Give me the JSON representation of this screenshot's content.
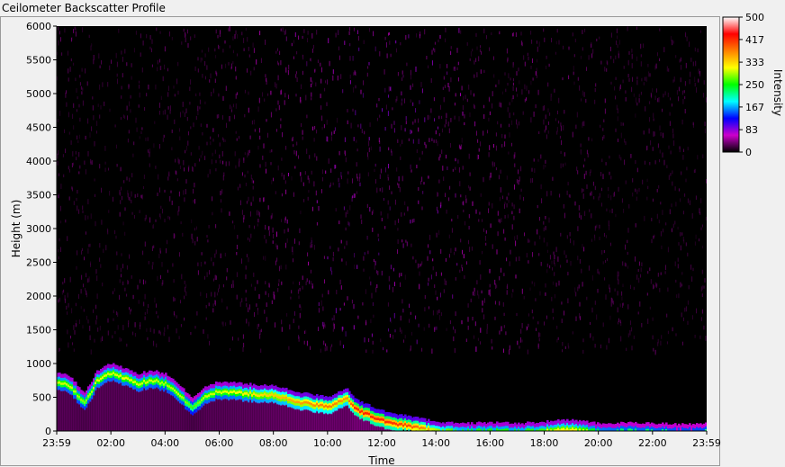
{
  "window": {
    "title": "Ceilometer Backscatter Profile"
  },
  "colors": {
    "background": "#000000",
    "scale": [
      "#000000",
      "#cc00cc",
      "#0000ff",
      "#00ffff",
      "#00ff00",
      "#ffff00",
      "#ff8000",
      "#ff0000",
      "#ffffff"
    ]
  },
  "chart_data": {
    "type": "heatmap",
    "title": "Ceilometer Backscatter Profile",
    "xlabel": "Time",
    "ylabel": "Height (m)",
    "x_ticks": [
      "23:59",
      "02:00",
      "04:00",
      "06:00",
      "08:00",
      "10:00",
      "12:00",
      "14:00",
      "16:00",
      "18:00",
      "20:00",
      "22:00",
      "23:59"
    ],
    "y_ticks": [
      0,
      500,
      1000,
      1500,
      2000,
      2500,
      3000,
      3500,
      4000,
      4500,
      5000,
      5500,
      6000
    ],
    "ylim": [
      0,
      6000
    ],
    "xlim_hours": [
      -0.0167,
      23.983
    ],
    "colorbar": {
      "label": "Intensity",
      "ticks": [
        0,
        83,
        167,
        250,
        333,
        417,
        500
      ],
      "range": [
        0,
        500
      ]
    },
    "boundary_layer_top": {
      "hour": [
        0,
        0.5,
        1.0,
        1.5,
        2.0,
        2.5,
        3.0,
        3.5,
        4.0,
        4.5,
        5.0,
        5.5,
        6.0,
        7.0,
        8.0,
        9.0,
        10.0,
        10.7,
        11.0,
        12.0,
        13.0,
        14.0,
        15.0,
        16.0,
        17.0,
        18.0,
        19.0,
        20.0,
        21.0,
        22.0,
        23.0,
        23.98
      ],
      "height_m": [
        820,
        760,
        500,
        850,
        950,
        880,
        800,
        850,
        800,
        650,
        420,
        620,
        680,
        650,
        620,
        520,
        450,
        600,
        420,
        250,
        170,
        90,
        60,
        80,
        60,
        90,
        120,
        60,
        70,
        70,
        50,
        60
      ],
      "peak_intensity": [
        300,
        300,
        280,
        310,
        300,
        310,
        300,
        300,
        290,
        300,
        260,
        300,
        300,
        320,
        340,
        360,
        380,
        360,
        420,
        420,
        400,
        340,
        300,
        300,
        300,
        310,
        320,
        280,
        270,
        270,
        260,
        260
      ]
    }
  }
}
